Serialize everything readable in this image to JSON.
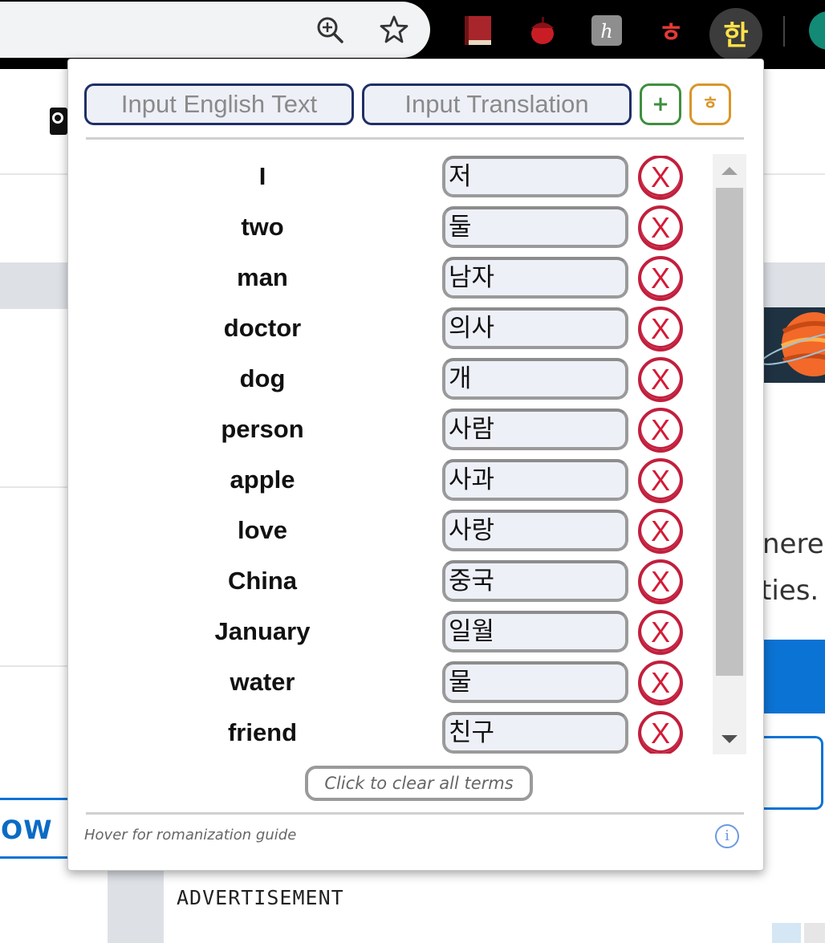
{
  "popup": {
    "english_placeholder": "Input English Text",
    "translation_placeholder": "Input Translation",
    "add_label": "+",
    "hangul_label": "ㅎ",
    "delete_label": "X",
    "terms": [
      {
        "english": "I",
        "translation": "저"
      },
      {
        "english": "two",
        "translation": "둘"
      },
      {
        "english": "man",
        "translation": "남자"
      },
      {
        "english": "doctor",
        "translation": "의사"
      },
      {
        "english": "dog",
        "translation": "개"
      },
      {
        "english": "person",
        "translation": "사람"
      },
      {
        "english": "apple",
        "translation": "사과"
      },
      {
        "english": "love",
        "translation": "사랑"
      },
      {
        "english": "China",
        "translation": "중국"
      },
      {
        "english": "January",
        "translation": "일월"
      },
      {
        "english": "water",
        "translation": "물"
      },
      {
        "english": "friend",
        "translation": "친구"
      }
    ],
    "clear_label": "Click to clear all terms",
    "footer_note": "Hover for romanization guide",
    "info_label": "i"
  },
  "toolbar": {
    "active_extension_label": "한",
    "hangul_ext_label": "ㅎ",
    "k_ext_label": "ℎ",
    "icons": [
      "zoom-in-icon",
      "star-icon",
      "book-icon",
      "acorn-icon",
      "k-icon",
      "hangul-icon",
      "han-icon"
    ]
  },
  "background": {
    "partial_text_1": "nere",
    "partial_text_2": "ties.",
    "left_button_text": "OW",
    "ad_label": "ADVERTISEMENT"
  },
  "colors": {
    "input_border": "#1f2f66",
    "add_border": "#3f8f3f",
    "hangul_border": "#d9962a",
    "delete_red": "#d41a35",
    "info_blue": "#6b9ae0"
  }
}
